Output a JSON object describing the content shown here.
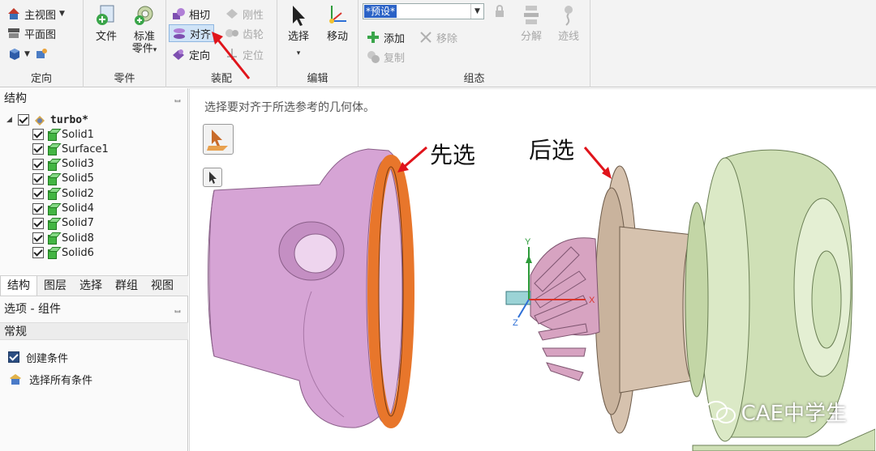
{
  "ribbon": {
    "orient": {
      "label": "定向",
      "main_view": "主视图",
      "plan_view": "平面图"
    },
    "parts": {
      "label": "零件",
      "file": "文件",
      "standard_line1": "标准",
      "standard_line2": "零件"
    },
    "assembly": {
      "label": "装配",
      "tangent": "相切",
      "align": "对齐",
      "orient": "定向",
      "rigid": "刚性",
      "gear": "齿轮",
      "position": "定位"
    },
    "edit": {
      "label": "编辑",
      "select": "选择",
      "move": "移动"
    },
    "config": {
      "label": "组态",
      "preset": "*预设*",
      "add": "添加",
      "remove": "移除",
      "copy": "复制",
      "explode": "分解",
      "trace": "迹线"
    }
  },
  "structure": {
    "title": "结构",
    "pin": "ᆸ",
    "root": "turbo*",
    "items": [
      "Solid1",
      "Surface1",
      "Solid3",
      "Solid5",
      "Solid2",
      "Solid4",
      "Solid7",
      "Solid8",
      "Solid6"
    ]
  },
  "tabs": [
    "结构",
    "图层",
    "选择",
    "群组",
    "视图"
  ],
  "options": {
    "title": "选项 - 组件",
    "section": "常规",
    "create_condition": "创建条件",
    "select_all_conditions": "选择所有条件"
  },
  "viewport": {
    "prompt": "选择要对齐于所选参考的几何体。",
    "annotation_first": "先选",
    "annotation_second": "后选",
    "axis_x": "X",
    "axis_y": "Y",
    "axis_z": "Z"
  },
  "watermark": "CAE中学生",
  "colors": {
    "purple_part": "#d7a6d6",
    "orange_face": "#e8762b",
    "tan_part": "#d6c2ae",
    "green_part": "#cfe0b6",
    "highlight": "#cfe3f7"
  }
}
